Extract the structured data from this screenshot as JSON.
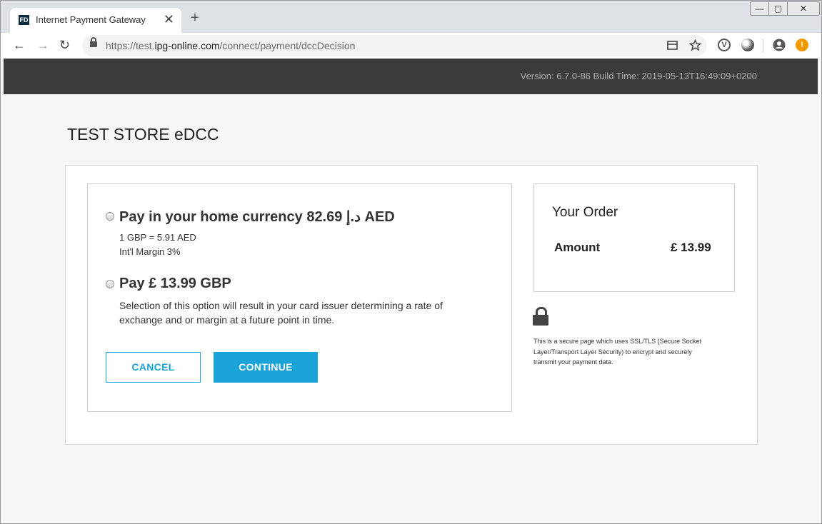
{
  "browser": {
    "tab": {
      "favicon_text": "FD",
      "title": "Internet Payment Gateway",
      "close_glyph": "✕"
    },
    "new_tab_glyph": "+",
    "window_controls": {
      "minimize": "—",
      "maximize": "▢",
      "close": "✕"
    },
    "nav": {
      "back": "←",
      "forward": "→",
      "reload": "↻"
    },
    "url": {
      "prefix": "https://test.",
      "host": "ipg-online.com",
      "path": "/connect/payment/dccDecision"
    },
    "icons": [
      "page-info-icon",
      "star-icon",
      "vivaldi-extension-icon",
      "incognito-extension-icon",
      "profile-icon",
      "warning-icon"
    ]
  },
  "header": {
    "version": "Version: 6.7.0-86 Build Time: 2019-05-13T16:49:09+0200"
  },
  "store": {
    "title": "TEST STORE eDCC"
  },
  "options": {
    "home_currency": {
      "title": "Pay in your home currency 82.69 د.إ AED",
      "rate": "1 GBP = 5.91 AED",
      "margin": "Int'l Margin 3%"
    },
    "card_currency": {
      "title": "Pay £ 13.99 GBP",
      "description": "Selection of this option will result in your card issuer determining a rate of exchange and or margin at a future point in time."
    }
  },
  "buttons": {
    "cancel": "CANCEL",
    "continue": "CONTINUE"
  },
  "order": {
    "title": "Your Order",
    "amount_label": "Amount",
    "amount_value": "£ 13.99"
  },
  "secure_notice": "This is a secure page which uses SSL/TLS (Secure Socket Layer/Transport Layer Security) to encrypt and securely transmit your payment data.",
  "colors": {
    "accent": "#1aa3d9",
    "header_bg": "#3b3b3b",
    "page_bg": "#f6f6f6"
  }
}
